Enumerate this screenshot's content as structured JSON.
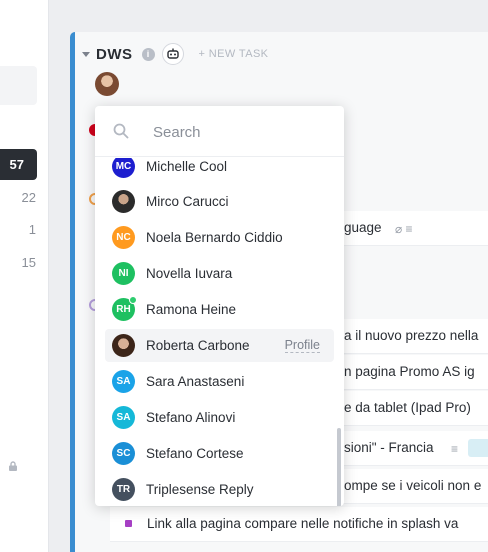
{
  "sidebar": {
    "counts": [
      "57",
      "22",
      "1",
      "15"
    ]
  },
  "list": {
    "title": "DWS",
    "info_icon": "i",
    "new_task_label": "+ NEW TASK",
    "border_color": "#3a8dd0"
  },
  "tasks": [
    {
      "text": "guage",
      "icons": "⌀ ≡"
    },
    {
      "text": "a il nuovo prezzo nella"
    },
    {
      "text": "n pagina Promo AS ig"
    },
    {
      "text": "e da tablet (Ipad Pro)"
    },
    {
      "text": "sioni\" - Francia",
      "icons": "≡"
    },
    {
      "text": "ompe se i veicoli non e"
    },
    {
      "text": "Link alla pagina compare nelle notifiche in splash va"
    }
  ],
  "assignee_dropdown": {
    "search_placeholder": "Search",
    "users": [
      {
        "initials": "MC",
        "name": "Michelle Cool",
        "color": "#1d1ecf"
      },
      {
        "initials": "",
        "name": "Mirco Carucci",
        "avatar": "photo-dark"
      },
      {
        "initials": "NC",
        "name": "Noela Bernardo Ciddio",
        "color": "#ff9a1f"
      },
      {
        "initials": "NI",
        "name": "Novella Iuvara",
        "color": "#1ec061"
      },
      {
        "initials": "RH",
        "name": "Ramona Heine",
        "color": "#1ec061",
        "online": true
      },
      {
        "initials": "",
        "name": "Roberta Carbone",
        "avatar": "photo-woman",
        "hover": true,
        "action": "Profile"
      },
      {
        "initials": "SA",
        "name": "Sara Anastaseni",
        "color": "#1aa3e8"
      },
      {
        "initials": "SA",
        "name": "Stefano Alinovi",
        "color": "#15b8d8"
      },
      {
        "initials": "SC",
        "name": "Stefano Cortese",
        "color": "#1a8fd6"
      },
      {
        "initials": "TR",
        "name": "Triplesense Reply",
        "color": "#44505f"
      }
    ]
  }
}
